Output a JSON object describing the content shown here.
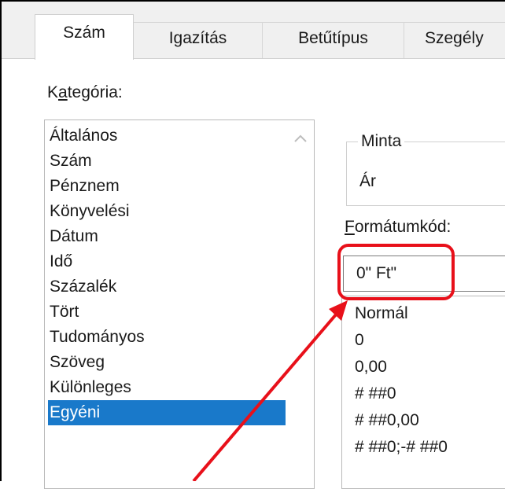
{
  "tabs": [
    {
      "label": "Szám",
      "active": true
    },
    {
      "label": "Igazítás",
      "active": false
    },
    {
      "label": "Betűtípus",
      "active": false
    },
    {
      "label": "Szegély",
      "active": false
    }
  ],
  "category": {
    "label_prefix": "K",
    "label_underlined": "a",
    "label_suffix": "tegória:",
    "items": [
      "Általános",
      "Szám",
      "Pénznem",
      "Könyvelési",
      "Dátum",
      "Idő",
      "Százalék",
      "Tört",
      "Tudományos",
      "Szöveg",
      "Különleges",
      "Egyéni"
    ],
    "selected": "Egyéni"
  },
  "sample": {
    "legend": "Minta",
    "value": "Ár"
  },
  "format_code": {
    "label_underlined": "F",
    "label_suffix": "ormátumkód:",
    "value": "0\" Ft\""
  },
  "format_list": [
    "Normál",
    "0",
    "0,00",
    "# ##0",
    "# ##0,00",
    "# ##0;-# ##0"
  ],
  "colors": {
    "selection": "#1979ca",
    "annotation": "#e8101a",
    "tab_background": "#f0f0f0"
  },
  "icons": {
    "scroll_up": "chevron-up-icon"
  }
}
